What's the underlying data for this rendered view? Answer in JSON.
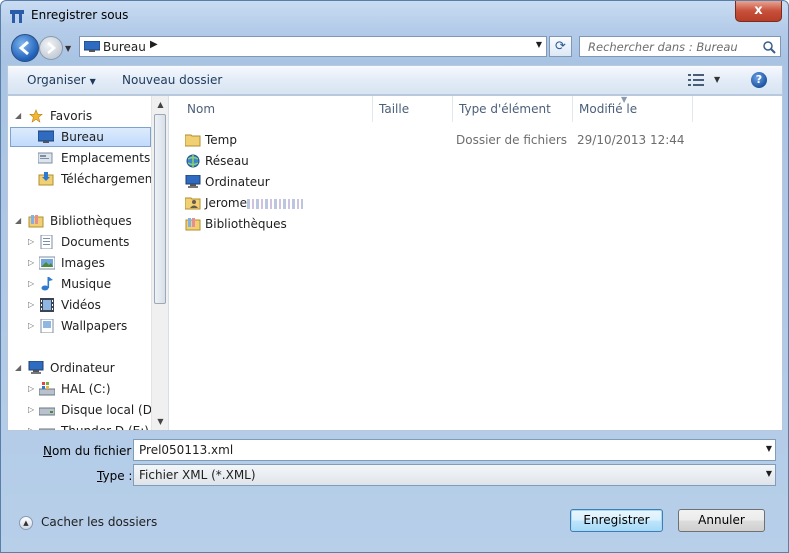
{
  "window": {
    "title": "Enregistrer sous",
    "close_symbol": "x"
  },
  "nav": {
    "address": "Bureau",
    "search_placeholder": "Rechercher dans : Bureau"
  },
  "toolbar": {
    "organize_label": "Organiser",
    "new_folder_label": "Nouveau dossier"
  },
  "sidebar": {
    "items": [
      {
        "label": "Favoris",
        "icon": "star-icon"
      },
      {
        "label": "Bureau",
        "icon": "desktop-icon",
        "selected": true
      },
      {
        "label": "Emplacements ré",
        "icon": "recent-places-icon"
      },
      {
        "label": "Téléchargements",
        "icon": "downloads-icon"
      },
      {
        "label": "Bibliothèques",
        "icon": "libraries-icon"
      },
      {
        "label": "Documents",
        "icon": "documents-icon"
      },
      {
        "label": "Images",
        "icon": "images-icon"
      },
      {
        "label": "Musique",
        "icon": "music-icon"
      },
      {
        "label": "Vidéos",
        "icon": "videos-icon"
      },
      {
        "label": "Wallpapers",
        "icon": "wallpapers-icon"
      },
      {
        "label": "Ordinateur",
        "icon": "computer-icon"
      },
      {
        "label": "HAL (C:)",
        "icon": "drive-icon"
      },
      {
        "label": "Disque local (D:)",
        "icon": "drive-icon"
      },
      {
        "label": "Thunder D (E:)",
        "icon": "drive-icon"
      }
    ]
  },
  "columns": {
    "name": "Nom",
    "size": "Taille",
    "type": "Type d'élément",
    "modified": "Modifié le"
  },
  "files": [
    {
      "name": "Temp",
      "type": "Dossier de fichiers",
      "modified": "29/10/2013 12:44",
      "icon": "folder-icon"
    },
    {
      "name": "Réseau",
      "type": "",
      "modified": "",
      "icon": "network-icon"
    },
    {
      "name": "Ordinateur",
      "type": "",
      "modified": "",
      "icon": "computer-icon"
    },
    {
      "name": "Jerome",
      "type": "",
      "modified": "",
      "icon": "user-folder-icon"
    },
    {
      "name": "Bibliothèques",
      "type": "",
      "modified": "",
      "icon": "libraries-icon"
    }
  ],
  "form": {
    "filename_label_prefix": "N",
    "filename_label_rest": "om du fichier :",
    "filename_value": "Prel050113.xml",
    "type_label_prefix": "T",
    "type_label_rest": "ype :",
    "type_value": "Fichier XML (*.XML)"
  },
  "footer": {
    "hide_folders_label": "Cacher les dossiers",
    "save_label": "Enregistrer",
    "cancel_label": "Annuler"
  },
  "colors": {
    "frame": "#b4cce9",
    "selection": "#c1dbfc",
    "close_button": "#c7503b"
  }
}
